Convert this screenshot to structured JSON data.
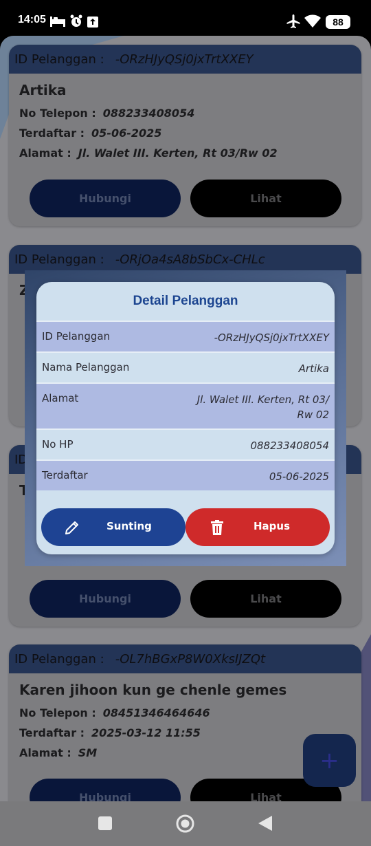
{
  "status_bar": {
    "time": "14:05",
    "battery": "88",
    "icons": [
      "bed-icon",
      "alarm-icon",
      "upload-icon",
      "airplane-icon",
      "wifi-icon",
      "battery-icon"
    ]
  },
  "customer_label": "ID Pelanggan :",
  "field_labels": {
    "phone": "No Telepon :",
    "registered": "Terdaftar :",
    "address": "Alamat :"
  },
  "cards": [
    {
      "id": "-ORzHJyQSj0jxTrtXXEY",
      "name": "Artika",
      "phone": "088233408054",
      "registered": "05-06-2025",
      "address": "Jl. Walet III. Kerten, Rt 03/Rw 02"
    },
    {
      "id": "-ORjOa4sA8bSbCx-CHLc",
      "name": "Z",
      "phone": "",
      "registered": "",
      "address": ""
    },
    {
      "id": "",
      "name": "T",
      "phone": "",
      "registered": "",
      "address": ""
    },
    {
      "id": "-OL7hBGxP8W0XksIJZQt",
      "name": "Karen jihoon kun ge chenle gemes",
      "phone": "08451346464646",
      "registered": "2025-03-12 11:55",
      "address": "SM"
    }
  ],
  "buttons": {
    "contact": "Hubungi",
    "view": "Lihat"
  },
  "fab": {
    "label": "+"
  },
  "dialog": {
    "title": "Detail Pelanggan",
    "rows": [
      {
        "key": "ID Pelanggan",
        "value": "-ORzHJyQSj0jxTrtXXEY"
      },
      {
        "key": "Nama Pelanggan",
        "value": "Artika"
      },
      {
        "key": "Alamat",
        "value_line1": "Jl. Walet III. Kerten, Rt 03/",
        "value_line2": "Rw 02"
      },
      {
        "key": "No HP",
        "value": "088233408054"
      },
      {
        "key": "Terdaftar",
        "value": "05-06-2025"
      }
    ],
    "edit_label": "Sunting",
    "delete_label": "Hapus"
  },
  "colors": {
    "primary": "#1e4393",
    "danger": "#cf2a2a",
    "dialog_bg": "#cfe0ee",
    "row_alt": "#aebae2"
  }
}
